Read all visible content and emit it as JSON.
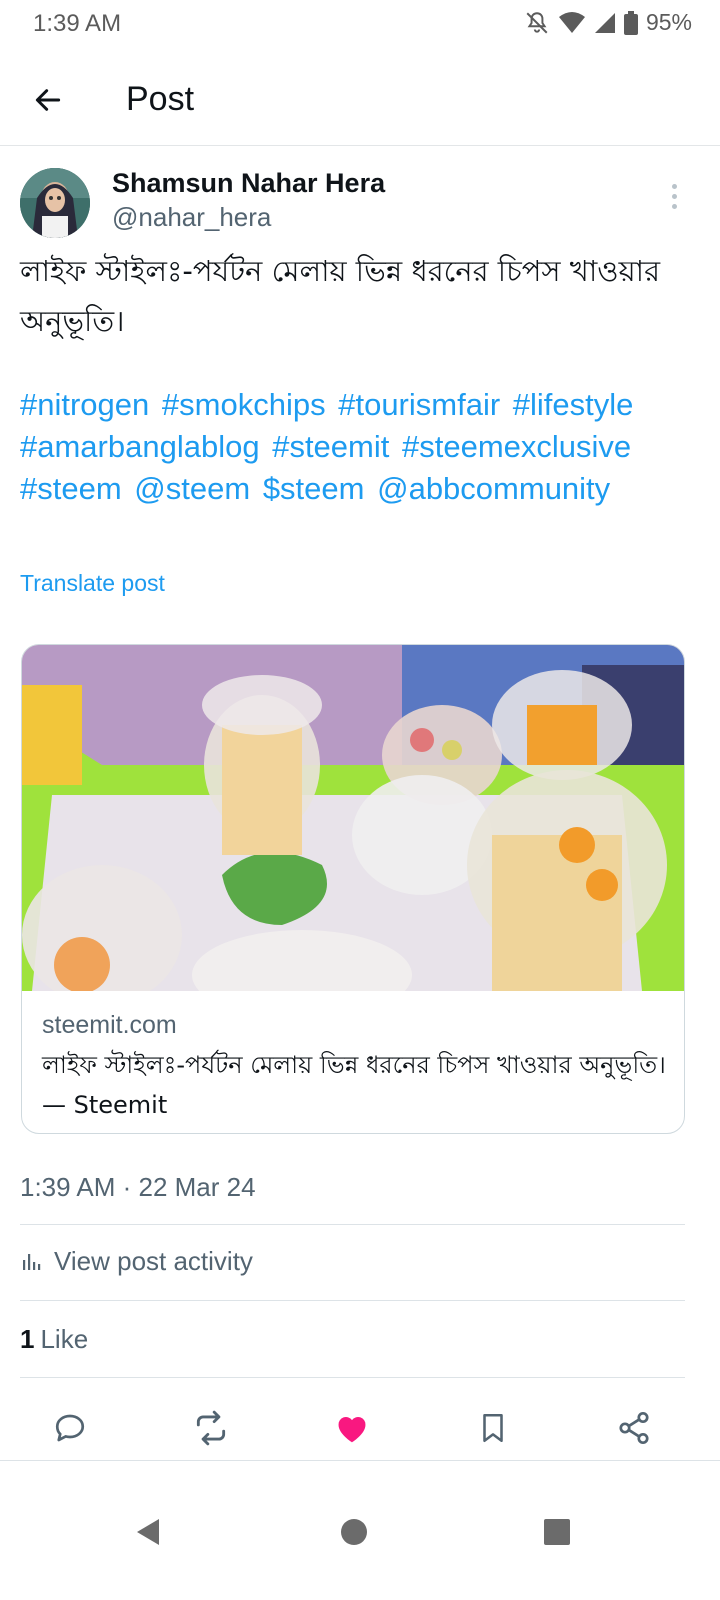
{
  "status_bar": {
    "time": "1:39 AM",
    "battery": "95%",
    "icons": [
      "bell-off-icon",
      "wifi-icon",
      "signal-icon",
      "battery-icon"
    ]
  },
  "header": {
    "title": "Post",
    "back_icon": "arrow-left-icon"
  },
  "post": {
    "author_name": "Shamsun Nahar Hera",
    "author_handle": "@nahar_hera",
    "text": "লাইফ স্টাইলঃ-পর্যটন মেলায় ভিন্ন ধরনের চিপস খাওয়ার অনুভূতি।",
    "tags": [
      "#nitrogen",
      "#smokchips",
      "#tourismfair",
      "#lifestyle",
      "#amarbanglablog",
      "#steemit",
      "#steemexclusive",
      "#steem",
      "@steem",
      "$steem",
      "@abbcommunity"
    ],
    "translate_label": "Translate post",
    "card": {
      "domain": "steemit.com",
      "title": "লাইফ স্টাইলঃ-পর্যটন মেলায় ভিন্ন ধরনের চিপস খাওয়ার অনুভূতি। — Steemit"
    },
    "timestamp": "1:39 AM · 22 Mar 24",
    "activity_label": "View post activity",
    "likes_count": "1",
    "likes_label": "Like"
  },
  "actions": [
    "reply-icon",
    "repost-icon",
    "like-icon",
    "bookmark-icon",
    "share-icon"
  ],
  "colors": {
    "accent": "#1d9bf0",
    "like": "#f91880",
    "text": "#0f1419",
    "secondary": "#536471"
  }
}
